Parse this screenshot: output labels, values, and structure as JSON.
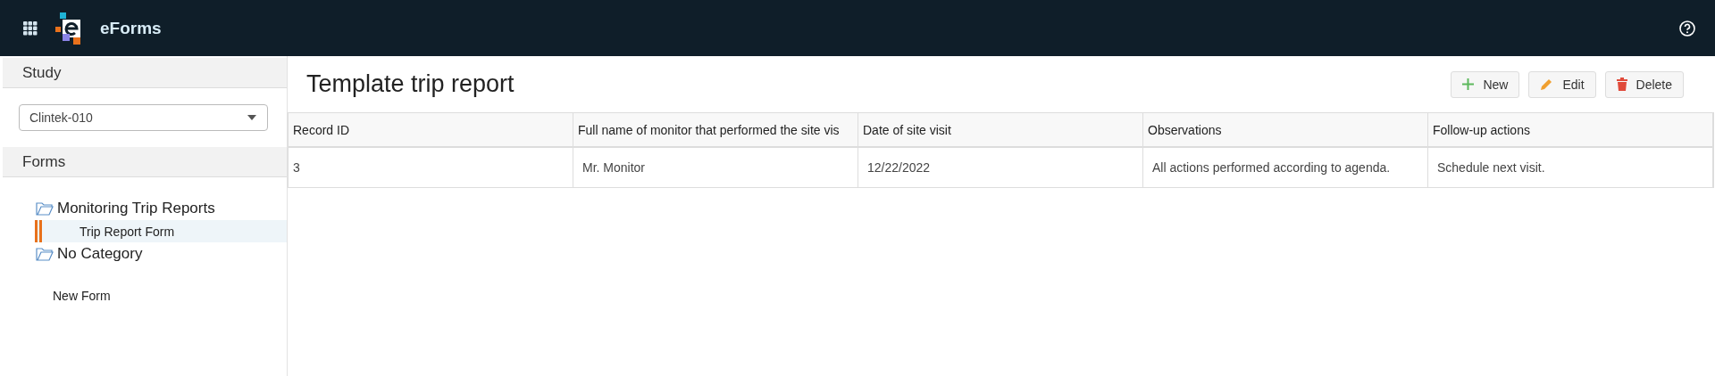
{
  "header": {
    "app_name": "eForms"
  },
  "sidebar": {
    "study_title": "Study",
    "study_select": {
      "value": "Clintek-010"
    },
    "forms_title": "Forms",
    "tree": [
      {
        "label": "Monitoring Trip Reports",
        "children": [
          {
            "label": "Trip Report Form",
            "selected": true
          }
        ]
      },
      {
        "label": "No Category"
      }
    ],
    "new_form": "New Form"
  },
  "main": {
    "title": "Template trip report",
    "buttons": [
      {
        "kind": "new",
        "label": "New"
      },
      {
        "kind": "edit",
        "label": "Edit"
      },
      {
        "kind": "delete",
        "label": "Delete"
      }
    ],
    "table": {
      "columns": [
        "Record ID",
        "Full name of monitor that performed the site vis",
        "Date of site visit",
        "Observations",
        "Follow-up actions"
      ],
      "rows": [
        [
          "3",
          "Mr. Monitor",
          "12/22/2022",
          "All actions performed according to agenda.",
          "Schedule next visit."
        ]
      ]
    }
  }
}
